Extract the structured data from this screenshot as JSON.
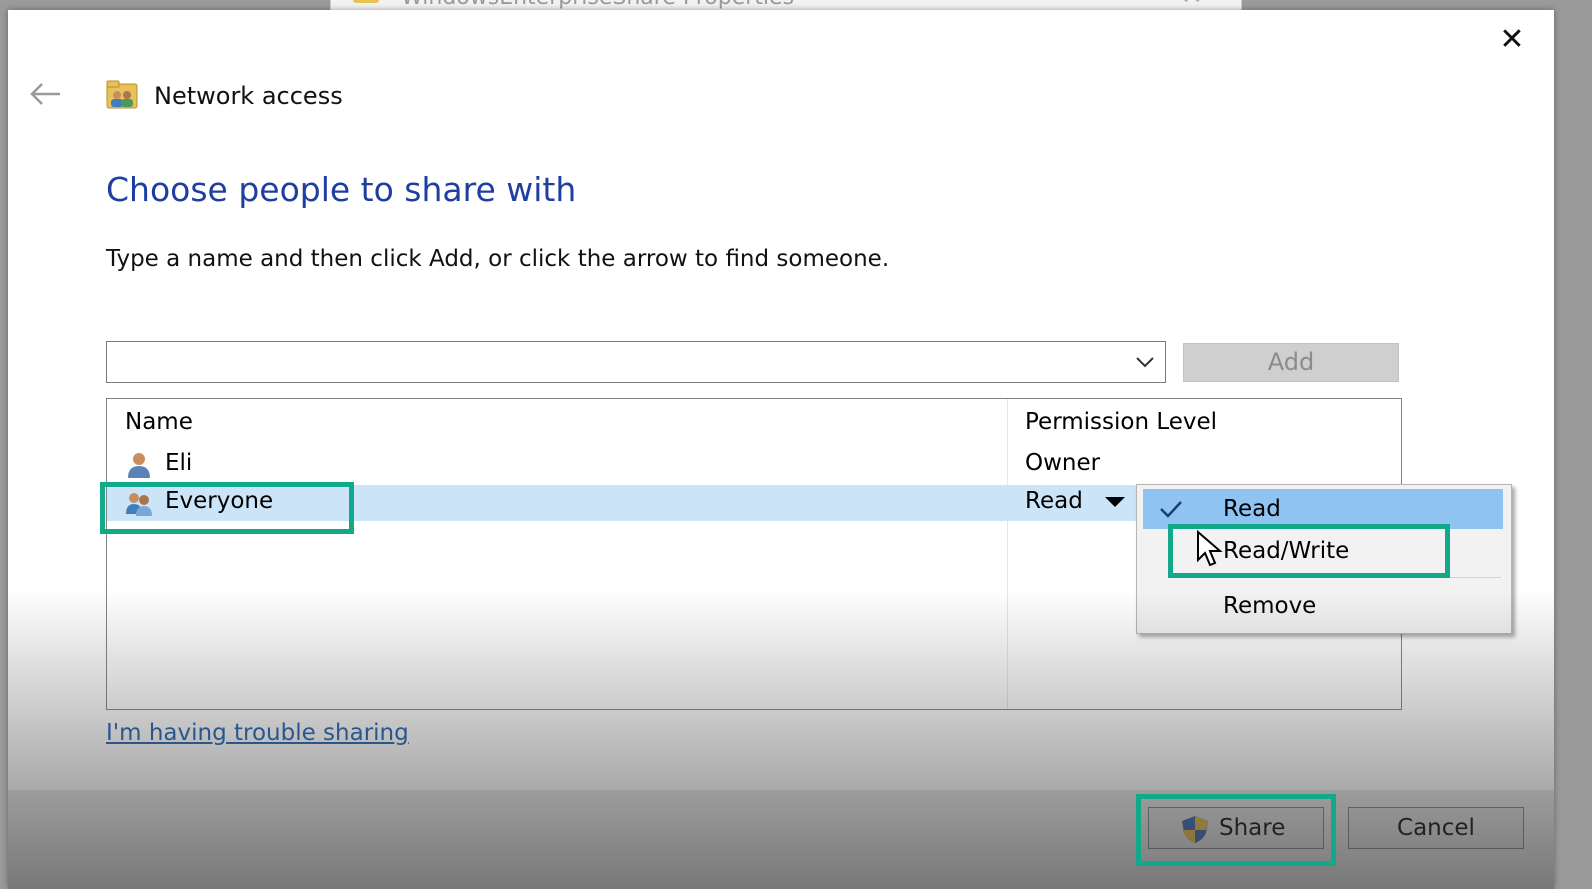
{
  "background_window": {
    "title": "WindowsEnterpriseShare Properties"
  },
  "header": {
    "title": "Network access",
    "back_icon": "back-arrow-icon",
    "close_icon": "close-icon"
  },
  "heading": "Choose people to share with",
  "instruction": "Type a name and then click Add, or click the arrow to find someone.",
  "name_combo": {
    "value": "",
    "placeholder": ""
  },
  "add_label": "Add",
  "table": {
    "columns": [
      "Name",
      "Permission Level"
    ],
    "rows": [
      {
        "name": "Eli",
        "permission": "Owner",
        "icon": "user-icon"
      },
      {
        "name": "Everyone",
        "permission": "Read",
        "icon": "group-icon",
        "selected": true
      }
    ]
  },
  "permission_menu": {
    "items": [
      {
        "label": "Read",
        "checked": true
      },
      {
        "label": "Read/Write",
        "checked": false
      },
      {
        "label": "Remove",
        "checked": false
      }
    ]
  },
  "help_link": "I'm having trouble sharing",
  "buttons": {
    "share": "Share",
    "cancel": "Cancel"
  },
  "colors": {
    "heading": "#1f3fa0",
    "selection": "#cce4f7",
    "menu_highlight": "#8fc3f2",
    "annotation_box": "#12a88a",
    "link": "#1a5fb4"
  }
}
